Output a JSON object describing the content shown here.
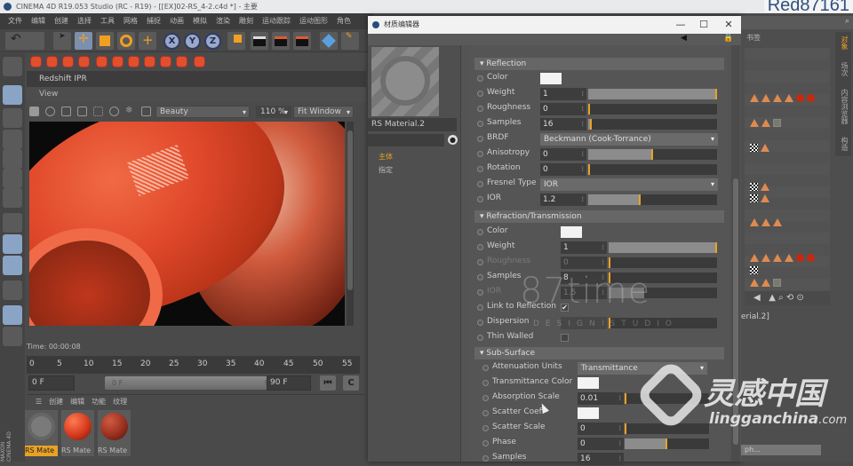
{
  "app": {
    "title": "CINEMA 4D R19.053 Studio (RC - R19) - [[EX]02-RS_4-2.c4d *] - 主要",
    "brand_watermark": "Red87161",
    "menu": [
      "文件",
      "编辑",
      "创建",
      "选择",
      "工具",
      "网格",
      "捕捉",
      "动画",
      "模拟",
      "渲染",
      "雕刻",
      "运动跟踪",
      "运动图形",
      "角色"
    ],
    "toolbar_axes": [
      "X",
      "Y",
      "Z"
    ]
  },
  "redshift_ipr": {
    "panel_title": "Redshift IPR",
    "view_menu": "View",
    "aov_select": "Beauty",
    "zoom": "110 %",
    "fit_select": "Fit Window",
    "time": "Time: 00:00:08"
  },
  "timeline": {
    "ticks": [
      "0",
      "5",
      "10",
      "15",
      "20",
      "25",
      "30",
      "35",
      "40",
      "45",
      "50",
      "55"
    ],
    "start_frame": "0 F",
    "range_start": "0 F",
    "range_end": "90 F",
    "end_frame": "90 F"
  },
  "material_manager": {
    "menu": [
      "创建",
      "编辑",
      "功能",
      "纹理"
    ],
    "materials": [
      {
        "label": "RS Mate",
        "selected": true,
        "color": "#8a8a8a"
      },
      {
        "label": "RS Mate",
        "selected": false,
        "color": "#d63a1c"
      },
      {
        "label": "RS Mate",
        "selected": false,
        "color": "#9a3020"
      }
    ],
    "side_label": "MAXON CINEMA 4D"
  },
  "material_editor": {
    "window_title": "材质编辑器",
    "material_name": "RS Material.2",
    "tabs": [
      "主体",
      "指定"
    ],
    "active_tab": "主体",
    "reflection": {
      "header": "Reflection",
      "color_label": "Color",
      "weight": {
        "label": "Weight",
        "value": "1",
        "fill": 1.0
      },
      "roughness": {
        "label": "Roughness",
        "value": "0",
        "fill": 0.0
      },
      "samples": {
        "label": "Samples",
        "value": "16",
        "fill": 0.03
      },
      "brdf": {
        "label": "BRDF",
        "value": "Beckmann (Cook-Torrance)"
      },
      "anisotropy": {
        "label": "Anisotropy",
        "value": "0",
        "fill": 0.5
      },
      "rotation": {
        "label": "Rotation",
        "value": "0",
        "fill": 0.0
      },
      "fresnel_type": {
        "label": "Fresnel Type",
        "value": "IOR"
      },
      "ior": {
        "label": "IOR",
        "value": "1.2",
        "fill": 0.41
      }
    },
    "refraction": {
      "header": "Refraction/Transmission",
      "color_label": "Color",
      "weight": {
        "label": "Weight",
        "value": "1",
        "fill": 1.0
      },
      "roughness": {
        "label": "Roughness",
        "value": "0",
        "fill": 0.0
      },
      "samples": {
        "label": "Samples",
        "value": "8",
        "fill": 0.02
      },
      "ior": {
        "label": "IOR",
        "value": "1.5",
        "fill": 0.33
      },
      "link_to_reflection": {
        "label": "Link to Reflection",
        "checked": true
      },
      "dispersion": {
        "label": "Dispersion",
        "value": "0",
        "fill": 0.0
      },
      "thin_walled": {
        "label": "Thin Walled",
        "checked": false
      }
    },
    "subsurface": {
      "header": "Sub-Surface",
      "attenuation_units": {
        "label": "Attenuation Units",
        "value": "Transmittance"
      },
      "transmittance_color": {
        "label": "Transmittance Color"
      },
      "absorption_scale": {
        "label": "Absorption Scale",
        "value": "0.01",
        "fill": 0.0
      },
      "scatter_coeff": {
        "label": "Scatter Coeff"
      },
      "scatter_scale": {
        "label": "Scatter Scale",
        "value": "0",
        "fill": 0.0
      },
      "phase": {
        "label": "Phase",
        "value": "0",
        "fill": 0.5
      },
      "samples": {
        "label": "Samples",
        "value": "16"
      }
    }
  },
  "right_panel": {
    "header": "书签",
    "vertical_tabs": [
      "对象",
      "场次",
      "内容浏览器",
      "构造"
    ],
    "attr_name": "erial.2]",
    "ph_field": "ph..."
  },
  "watermarks": {
    "site_87": "87time",
    "site_87_sub": "DESIGN STUDIO",
    "lg_cn": "灵感中国",
    "lg_en": "lingganchina",
    "lg_tld": ".com"
  }
}
